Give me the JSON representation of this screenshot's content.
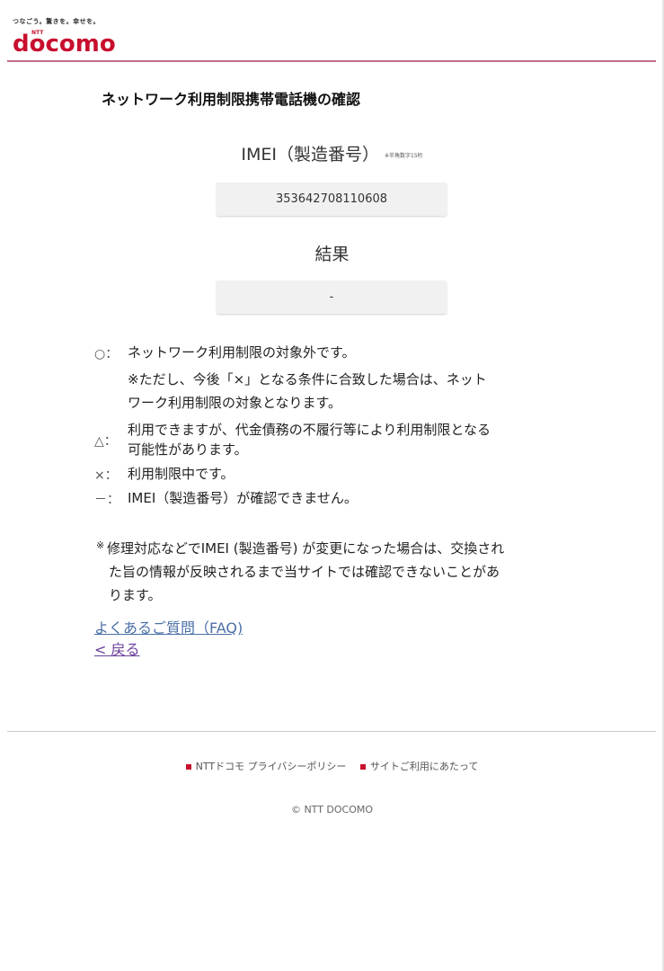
{
  "header": {
    "tagline": "つなごう。驚きを。幸せを。",
    "logo_sub": "NTT",
    "logo": "docomo"
  },
  "page_title": "ネットワーク利用制限携帯電話機の確認",
  "imei": {
    "label": "IMEI（製造番号）",
    "note": "※半角数字15桁",
    "value": "353642708110608"
  },
  "result": {
    "label": "結果",
    "value": "-"
  },
  "legend": [
    {
      "symbol": "○：",
      "lines": [
        "ネットワーク利用制限の対象外です。",
        "※ただし、今後「×」となる条件に合致した場合は、ネット",
        "ワーク利用制限の対象となります。"
      ]
    },
    {
      "symbol": "△：",
      "lines": [
        "利用できますが、代金債務の不履行等により利用制限となる",
        "可能性があります。"
      ]
    },
    {
      "symbol": "×：",
      "lines": [
        "利用制限中です。"
      ]
    },
    {
      "symbol": "－：",
      "lines": [
        "IMEI（製造番号）が確認できません。"
      ]
    }
  ],
  "note": {
    "star": "※",
    "lines": [
      "修理対応などでIMEI (製造番号) が変更になった場合は、交換され",
      "た旨の情報が反映されるまで当サイトでは確認できないことがあ",
      "ります。"
    ]
  },
  "links": {
    "faq": "よくあるご質問（FAQ)",
    "back": "< 戻る"
  },
  "footer": {
    "links": [
      "NTTドコモ プライバシーポリシー",
      "サイトご利用にあたって"
    ],
    "copyright": "© NTT DOCOMO"
  },
  "colors": {
    "brand": "#c8102e",
    "link": "#4a6fa5",
    "visited_link": "#6b3f9c",
    "header_line": "#c46a8a"
  }
}
